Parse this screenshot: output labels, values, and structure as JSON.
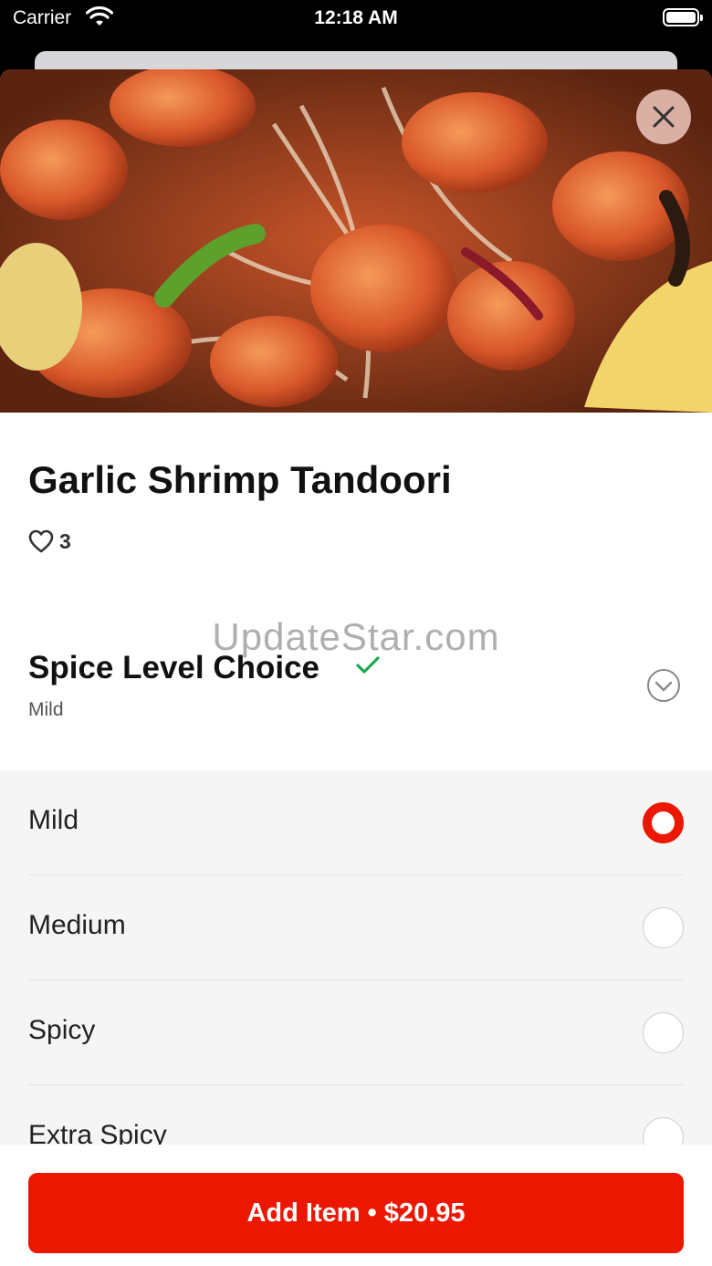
{
  "status_bar": {
    "carrier": "Carrier",
    "time": "12:18 AM"
  },
  "item": {
    "title": "Garlic Shrimp Tandoori",
    "likes": "3",
    "hero_image": "shrimp-dish-photo"
  },
  "watermark": "UpdateStar.com",
  "spice_section": {
    "title": "Spice Level Choice",
    "selected_summary": "Mild",
    "options": [
      {
        "label": "Mild",
        "selected": true
      },
      {
        "label": "Medium",
        "selected": false
      },
      {
        "label": "Spicy",
        "selected": false
      },
      {
        "label": "Extra Spicy",
        "selected": false
      }
    ]
  },
  "footer": {
    "add_button_label": "Add Item • $20.95"
  },
  "colors": {
    "accent": "#eb1700",
    "check": "#1fa750"
  },
  "icons": [
    "wifi-icon",
    "battery-icon",
    "close-icon",
    "heart-icon",
    "check-icon",
    "chevron-down-icon"
  ]
}
